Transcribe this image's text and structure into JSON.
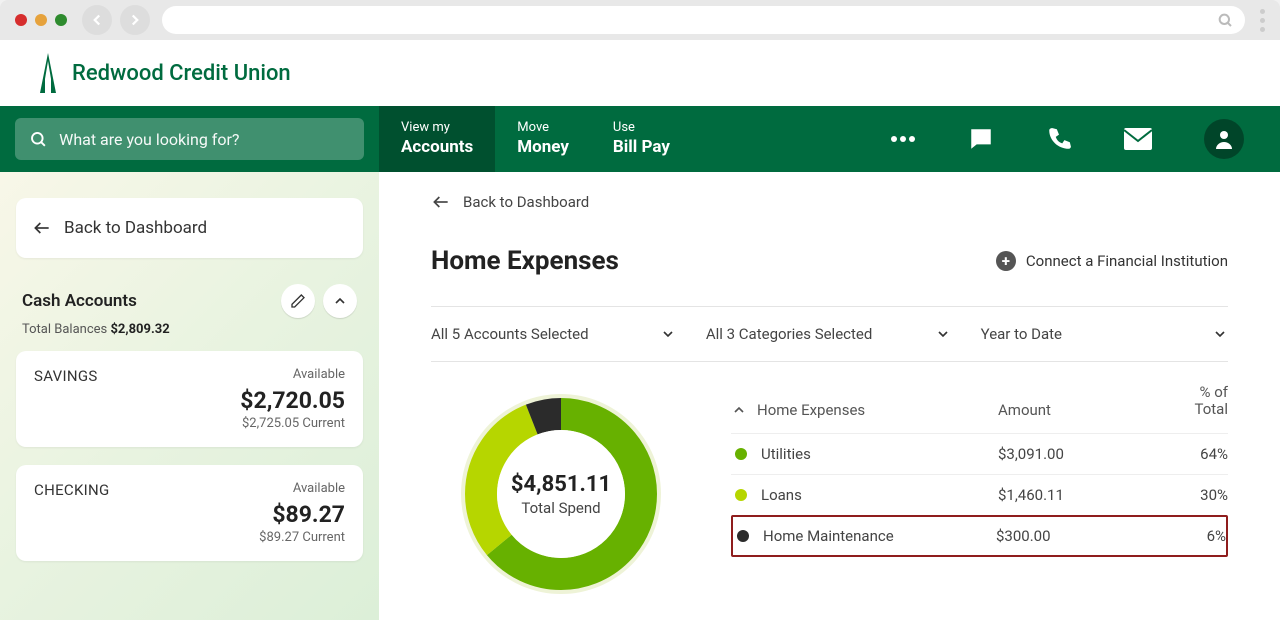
{
  "logo_text": "Redwood Credit Union",
  "search": {
    "placeholder": "What are you looking for?"
  },
  "nav": {
    "tabs": [
      {
        "top": "View my",
        "bottom": "Accounts",
        "active": true
      },
      {
        "top": "Move",
        "bottom": "Money",
        "active": false
      },
      {
        "top": "Use",
        "bottom": "Bill Pay",
        "active": false
      }
    ]
  },
  "sidebar": {
    "back_label": "Back to Dashboard",
    "section_title": "Cash Accounts",
    "balances_prefix": "Total Balances ",
    "balances_value": "$2,809.32",
    "accounts": [
      {
        "name": "SAVINGS",
        "available_label": "Available",
        "amount": "$2,720.05",
        "current": "$2,725.05 Current"
      },
      {
        "name": "CHECKING",
        "available_label": "Available",
        "amount": "$89.27",
        "current": "$89.27 Current"
      }
    ]
  },
  "content": {
    "back_link": "Back to Dashboard",
    "page_title": "Home Expenses",
    "connect_label": "Connect a Financial Institution",
    "filters": [
      "All 5 Accounts Selected",
      "All 3 Categories Selected",
      "Year to Date"
    ],
    "total_spend_amount": "$4,851.11",
    "total_spend_label": "Total Spend",
    "table": {
      "category_header": "Home Expenses",
      "amount_header": "Amount",
      "pct_header_top": "% of",
      "pct_header_bottom": "Total",
      "rows": [
        {
          "name": "Utilities",
          "amount": "$3,091.00",
          "pct": "64%",
          "color": "#67b100"
        },
        {
          "name": "Loans",
          "amount": "$1,460.11",
          "pct": "30%",
          "color": "#b6d600"
        },
        {
          "name": "Home Maintenance",
          "amount": "$300.00",
          "pct": "6%",
          "color": "#2b2b2b",
          "highlight": true
        }
      ]
    }
  },
  "chart_data": {
    "type": "pie",
    "title": "Home Expenses",
    "total_label": "Total Spend",
    "total": 4851.11,
    "series": [
      {
        "name": "Utilities",
        "value": 3091.0,
        "pct": 64,
        "color": "#67b100"
      },
      {
        "name": "Loans",
        "value": 1460.11,
        "pct": 30,
        "color": "#b6d600"
      },
      {
        "name": "Home Maintenance",
        "value": 300.0,
        "pct": 6,
        "color": "#2b2b2b"
      }
    ]
  }
}
